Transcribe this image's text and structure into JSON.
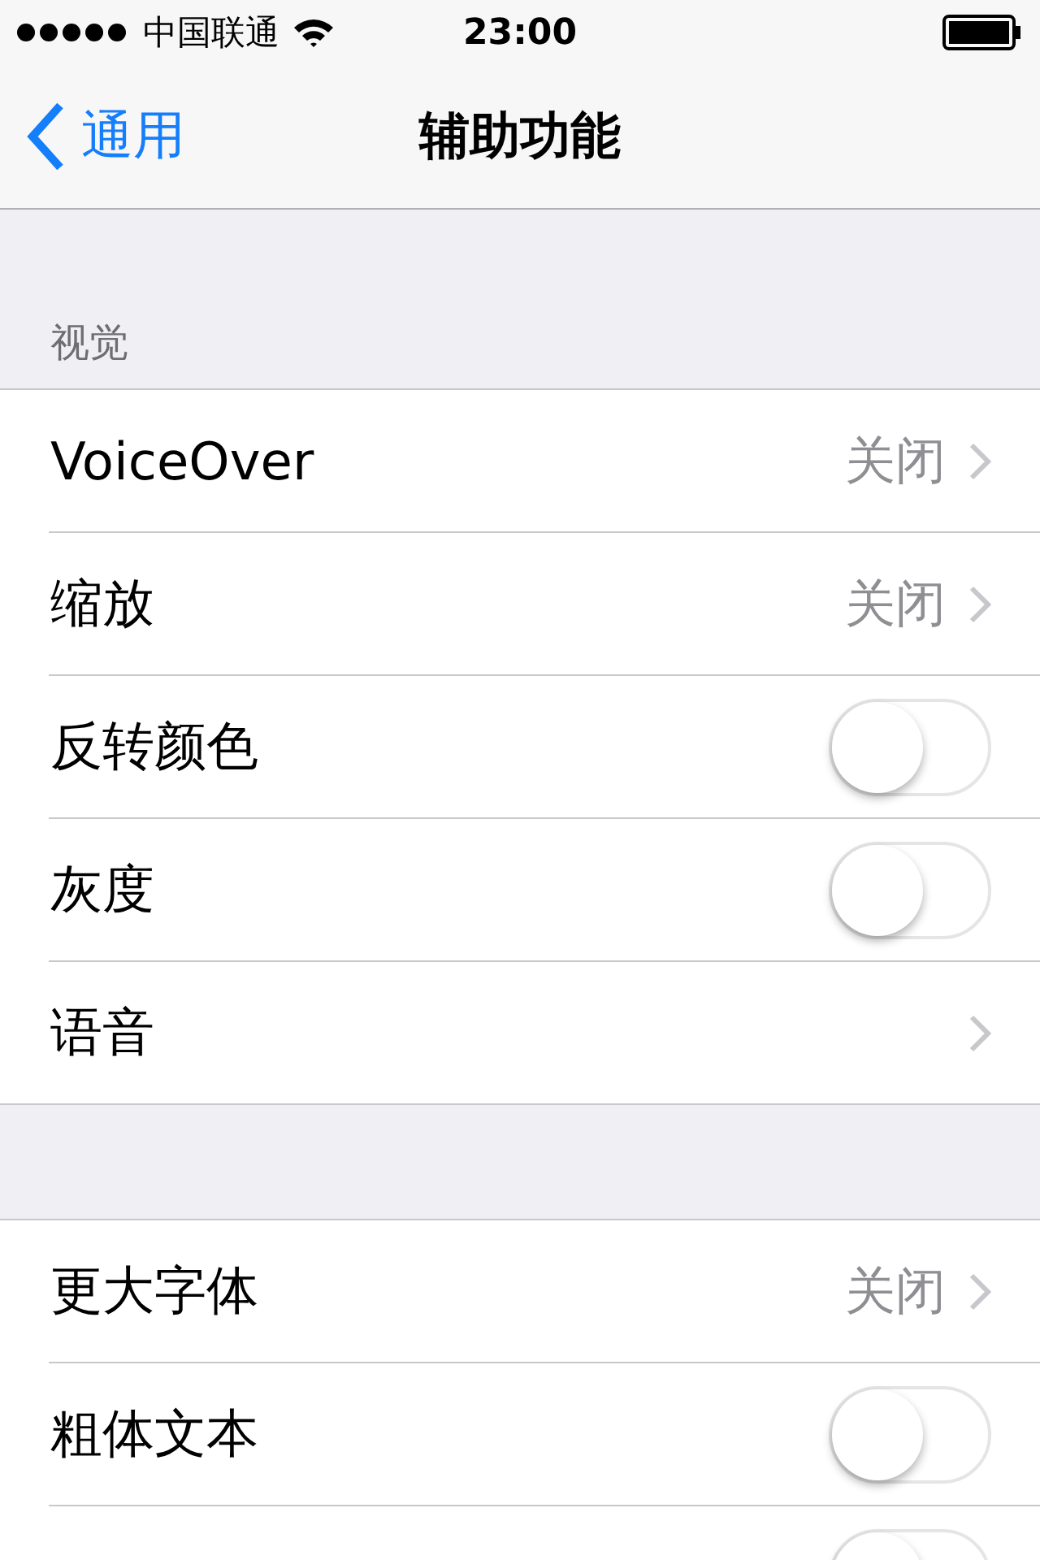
{
  "status_bar": {
    "carrier": "中国联通",
    "time": "23:00"
  },
  "nav": {
    "back": "通用",
    "title": "辅助功能"
  },
  "groups": [
    {
      "header": "视觉",
      "rows": [
        {
          "kind": "detail",
          "label": "VoiceOver",
          "value": "关闭"
        },
        {
          "kind": "detail",
          "label": "缩放",
          "value": "关闭"
        },
        {
          "kind": "toggle",
          "label": "反转颜色",
          "on": false
        },
        {
          "kind": "toggle",
          "label": "灰度",
          "on": false
        },
        {
          "kind": "link",
          "label": "语音"
        }
      ]
    },
    {
      "rows": [
        {
          "kind": "detail",
          "label": "更大字体",
          "value": "关闭"
        },
        {
          "kind": "toggle",
          "label": "粗体文本",
          "on": false
        },
        {
          "kind": "toggle",
          "on": false
        }
      ]
    }
  ]
}
